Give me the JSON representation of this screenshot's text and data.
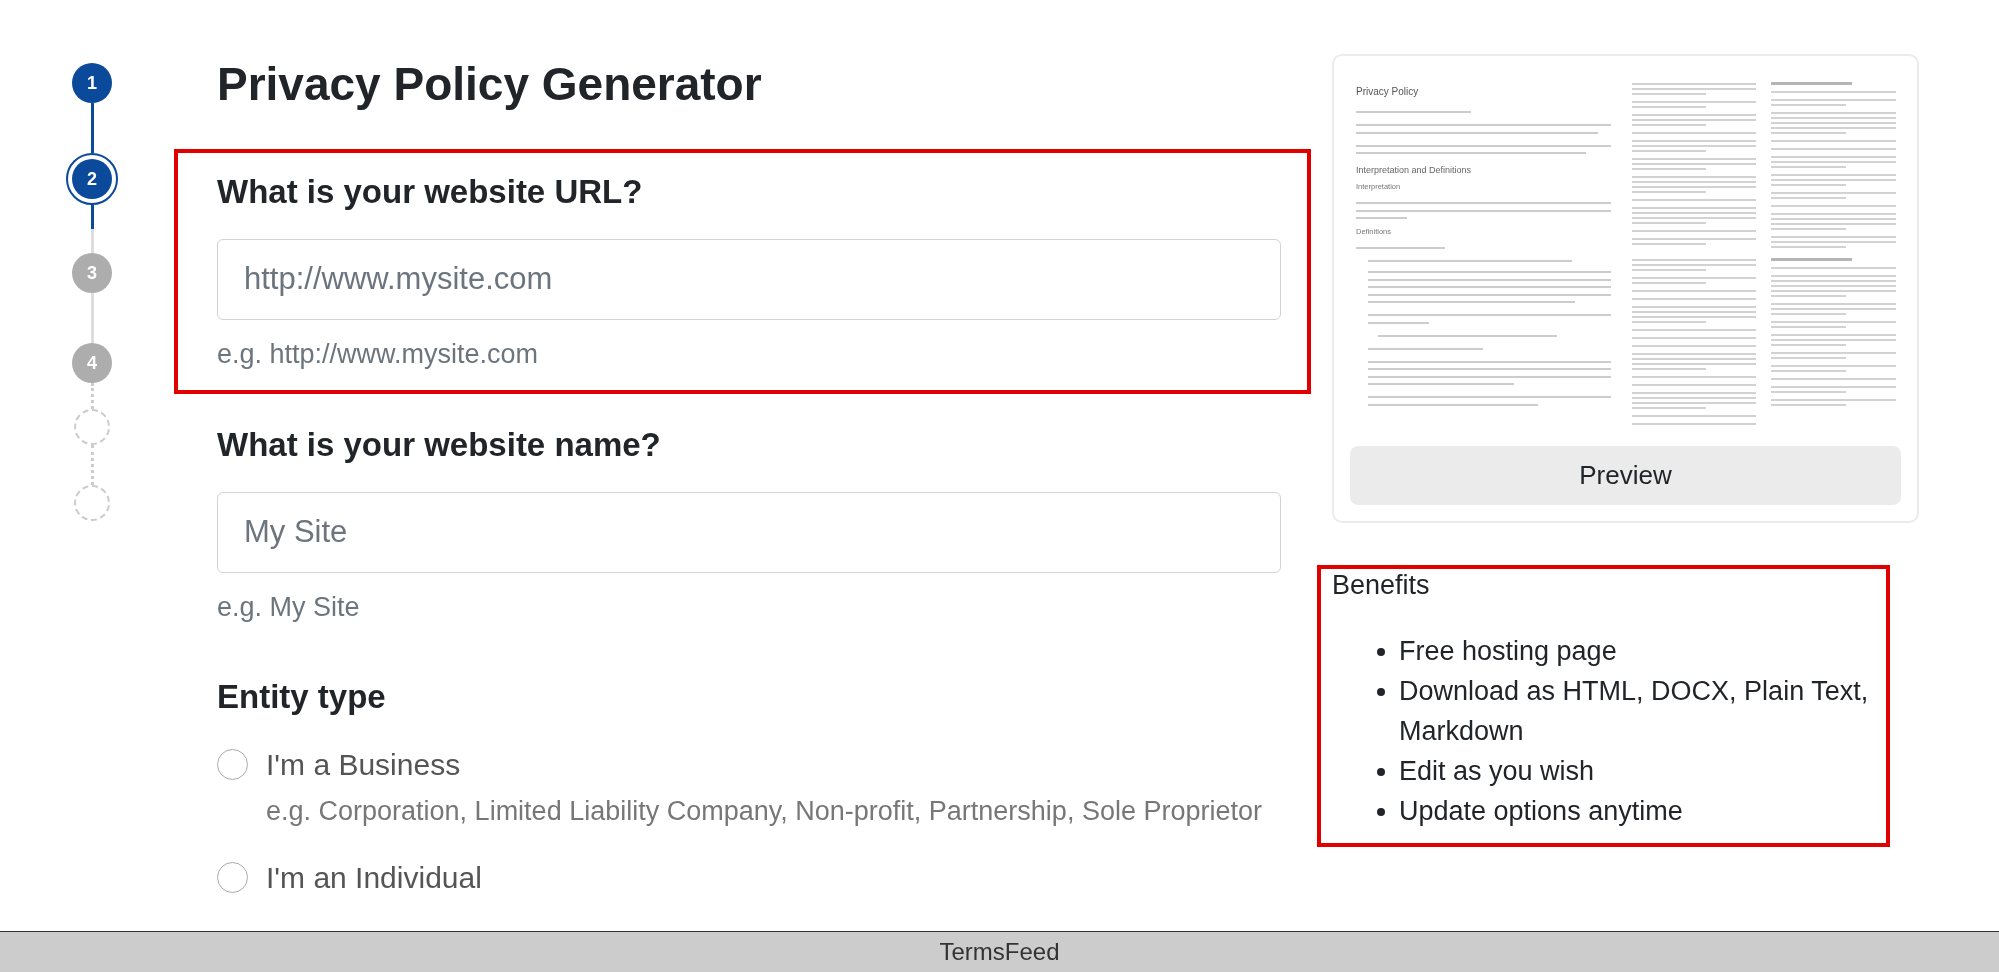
{
  "stepper": {
    "steps": [
      {
        "kind": "numbered",
        "label": "1",
        "completed": true,
        "selected": false
      },
      {
        "kind": "numbered",
        "label": "2",
        "completed": false,
        "selected": true
      },
      {
        "kind": "numbered",
        "label": "3",
        "completed": false,
        "selected": false
      },
      {
        "kind": "numbered",
        "label": "4",
        "completed": false,
        "selected": false
      },
      {
        "kind": "empty"
      },
      {
        "kind": "empty"
      }
    ]
  },
  "title": "Privacy Policy Generator",
  "questions": [
    {
      "heading": "What is your website URL?",
      "placeholder": "http://www.mysite.com",
      "hint": "e.g. http://www.mysite.com",
      "highlighted": true
    },
    {
      "heading": "What is your website name?",
      "placeholder": "My Site",
      "hint": "e.g. My Site",
      "highlighted": false
    }
  ],
  "entity_type": {
    "heading": "Entity type",
    "options": [
      {
        "label": "I'm a Business",
        "hint": "e.g. Corporation, Limited Liability Company, Non-profit, Partnership, Sole Proprietor",
        "selected": false
      },
      {
        "label": "I'm an Individual",
        "selected": false
      }
    ]
  },
  "preview": {
    "document": {
      "title": "Privacy Policy",
      "heading": "Interpretation and Definitions",
      "subheadings": [
        "Interpretation",
        "Definitions"
      ]
    },
    "button": "Preview"
  },
  "benefits": {
    "heading": "Benefits",
    "highlighted": true,
    "items": [
      "Free hosting page",
      "Download as HTML, DOCX, Plain Text, Markdown",
      "Edit as you wish",
      "Update options anytime"
    ]
  },
  "footer": {
    "text": "TermsFeed"
  }
}
